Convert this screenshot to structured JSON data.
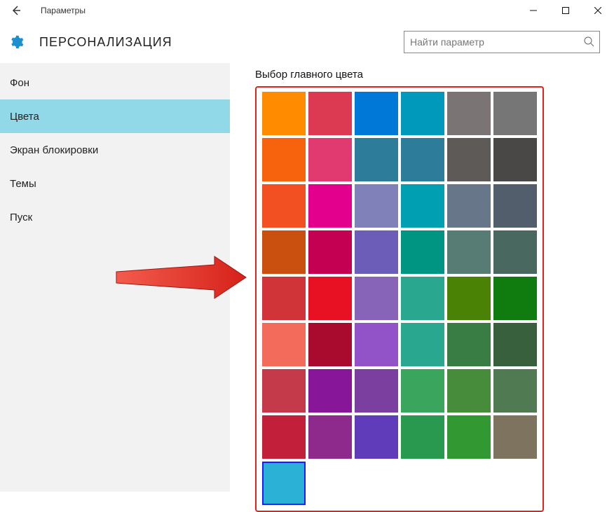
{
  "window": {
    "title": "Параметры"
  },
  "header": {
    "section_title": "ПЕРСОНАЛИЗАЦИЯ",
    "search_placeholder": "Найти параметр"
  },
  "sidebar": {
    "items": [
      {
        "label": "Фон",
        "active": false
      },
      {
        "label": "Цвета",
        "active": true
      },
      {
        "label": "Экран блокировки",
        "active": false
      },
      {
        "label": "Темы",
        "active": false
      },
      {
        "label": "Пуск",
        "active": false
      }
    ]
  },
  "main": {
    "heading": "Выбор главного цвета",
    "selected_color": "#2cb1d6",
    "colors": [
      "#ff8c00",
      "#db3a52",
      "#0078d7",
      "#0099bc",
      "#7a7574",
      "#767676",
      "#f7630c",
      "#e13a70",
      "#2d7d9a",
      "#2d7d9a",
      "#5d5a58",
      "#4a4846",
      "#f25022",
      "#e3008c",
      "#8081b8",
      "#009fb1",
      "#68768a",
      "#525e6b",
      "#ca5010",
      "#c30052",
      "#6b5db8",
      "#009482",
      "#567c73",
      "#486860",
      "#d13438",
      "#e81123",
      "#8764b8",
      "#2aa78f",
      "#498205",
      "#107c10",
      "#f26b5b",
      "#a80b2e",
      "#9253c9",
      "#2aa78f",
      "#3a7d44",
      "#39603d",
      "#c53a4b",
      "#871798",
      "#7b3fa0",
      "#3aa65d",
      "#468c3a",
      "#4f7a52",
      "#c2203a",
      "#8e2a8c",
      "#603cba",
      "#299950",
      "#329832",
      "#7e735f",
      "#2cb1d6"
    ]
  }
}
